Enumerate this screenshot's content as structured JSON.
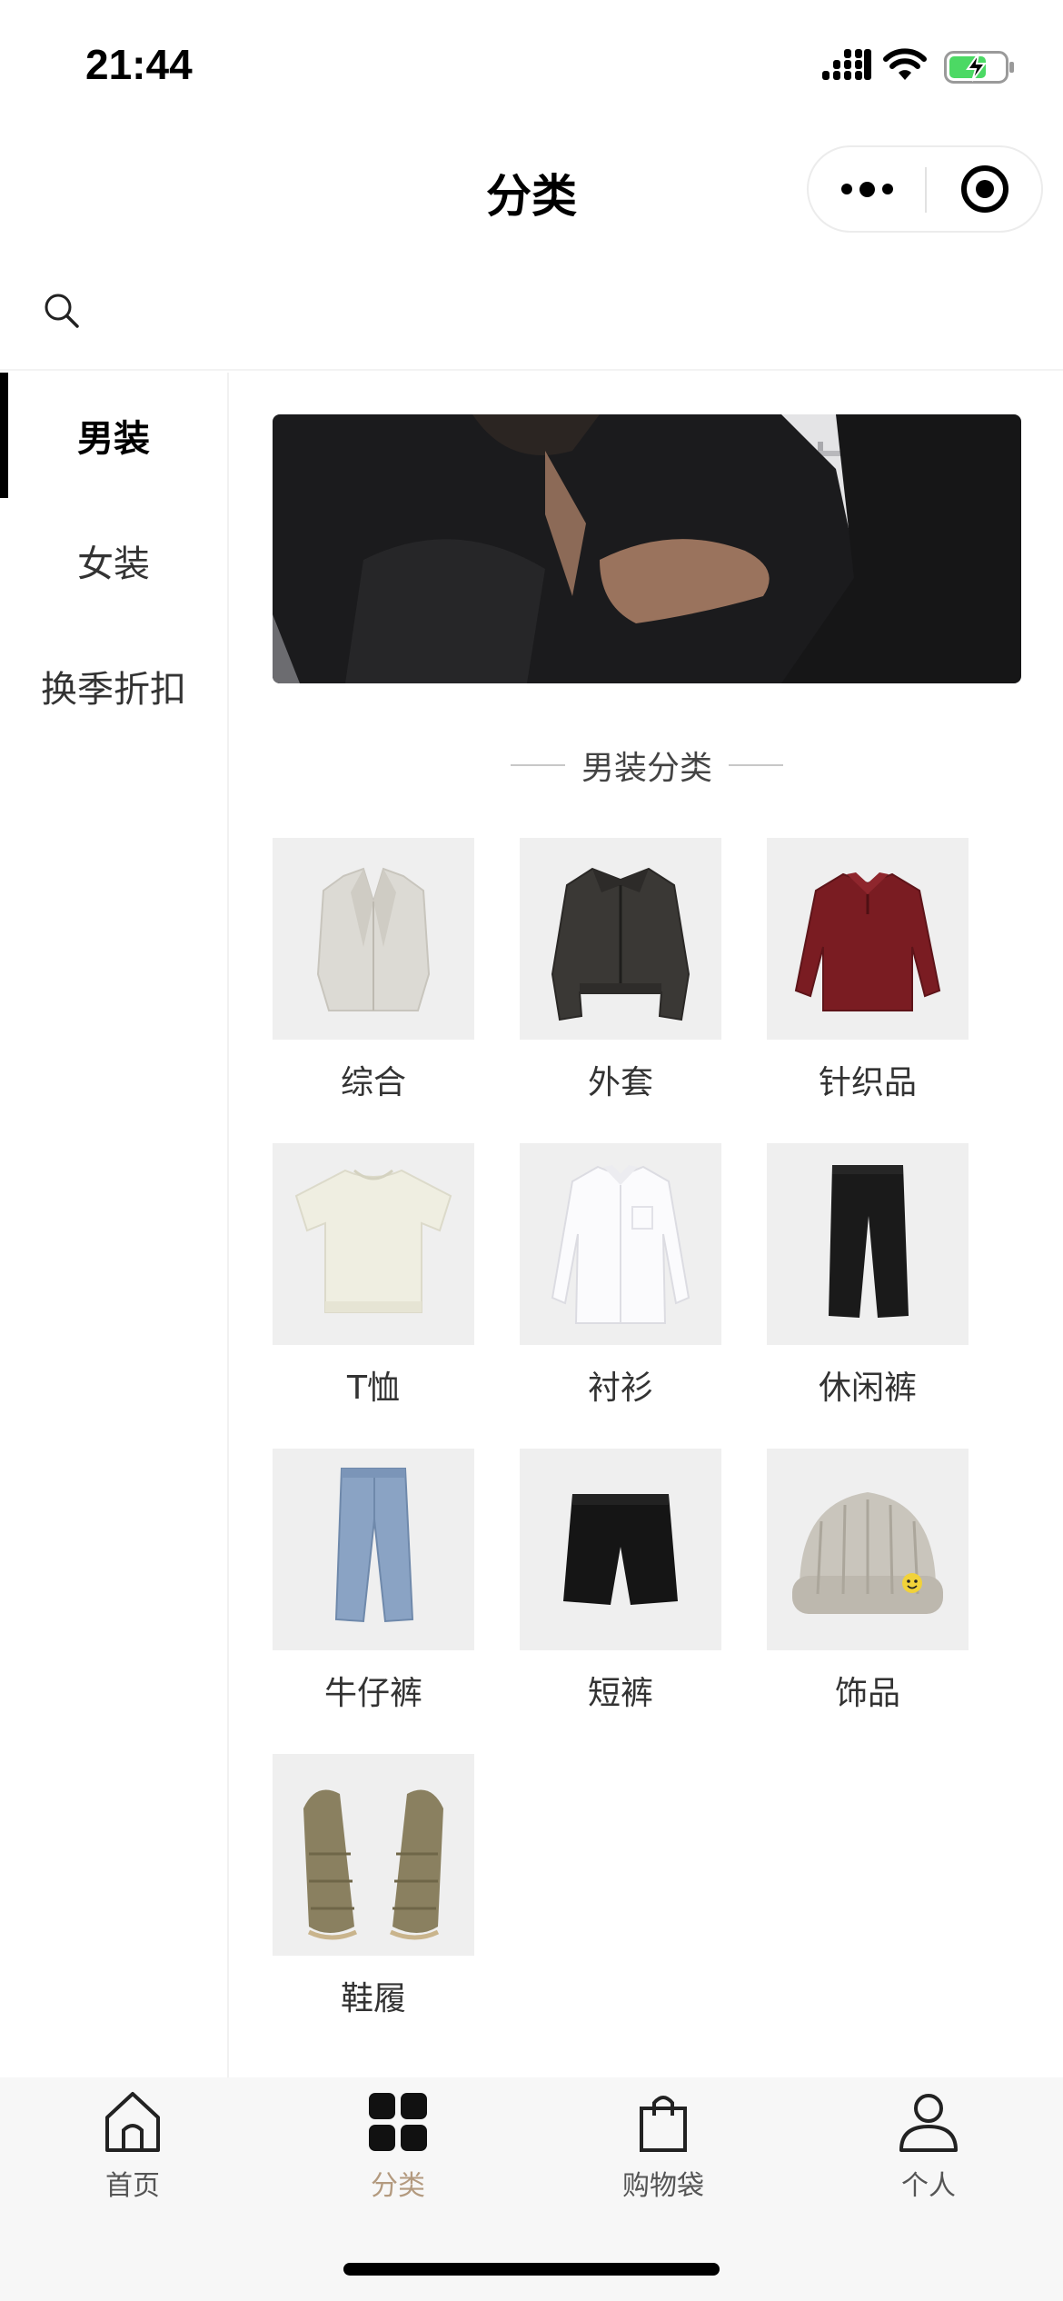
{
  "status_bar": {
    "time": "21:44",
    "icons": [
      "signal-icon",
      "wifi-icon",
      "battery-charging-icon"
    ],
    "battery_color": "#4cd964"
  },
  "nav": {
    "title": "分类",
    "capsule_icons": [
      "more-icon",
      "close-target-icon"
    ]
  },
  "search": {
    "icon": "search-icon"
  },
  "sidebar": {
    "items": [
      {
        "label": "男装",
        "active": true
      },
      {
        "label": "女装",
        "active": false
      },
      {
        "label": "换季折扣",
        "active": false
      }
    ]
  },
  "content": {
    "section_title": "男装分类",
    "categories": [
      {
        "label": "综合",
        "image": "light-blazer"
      },
      {
        "label": "外套",
        "image": "leather-jacket"
      },
      {
        "label": "针织品",
        "image": "red-knit-sweater"
      },
      {
        "label": "T恤",
        "image": "cream-tshirt"
      },
      {
        "label": "衬衫",
        "image": "white-shirt"
      },
      {
        "label": "休闲裤",
        "image": "black-trousers"
      },
      {
        "label": "牛仔裤",
        "image": "blue-jeans"
      },
      {
        "label": "短裤",
        "image": "black-shorts"
      },
      {
        "label": "饰品",
        "image": "beanie-hat"
      },
      {
        "label": "鞋履",
        "image": "woven-sandals"
      }
    ]
  },
  "tab_bar": {
    "items": [
      {
        "label": "首页",
        "icon": "home-icon",
        "active": false
      },
      {
        "label": "分类",
        "icon": "category-grid-icon",
        "active": true
      },
      {
        "label": "购物袋",
        "icon": "shopping-bag-icon",
        "active": false
      },
      {
        "label": "个人",
        "icon": "person-icon",
        "active": false
      }
    ],
    "active_color": "#b39a7f"
  }
}
